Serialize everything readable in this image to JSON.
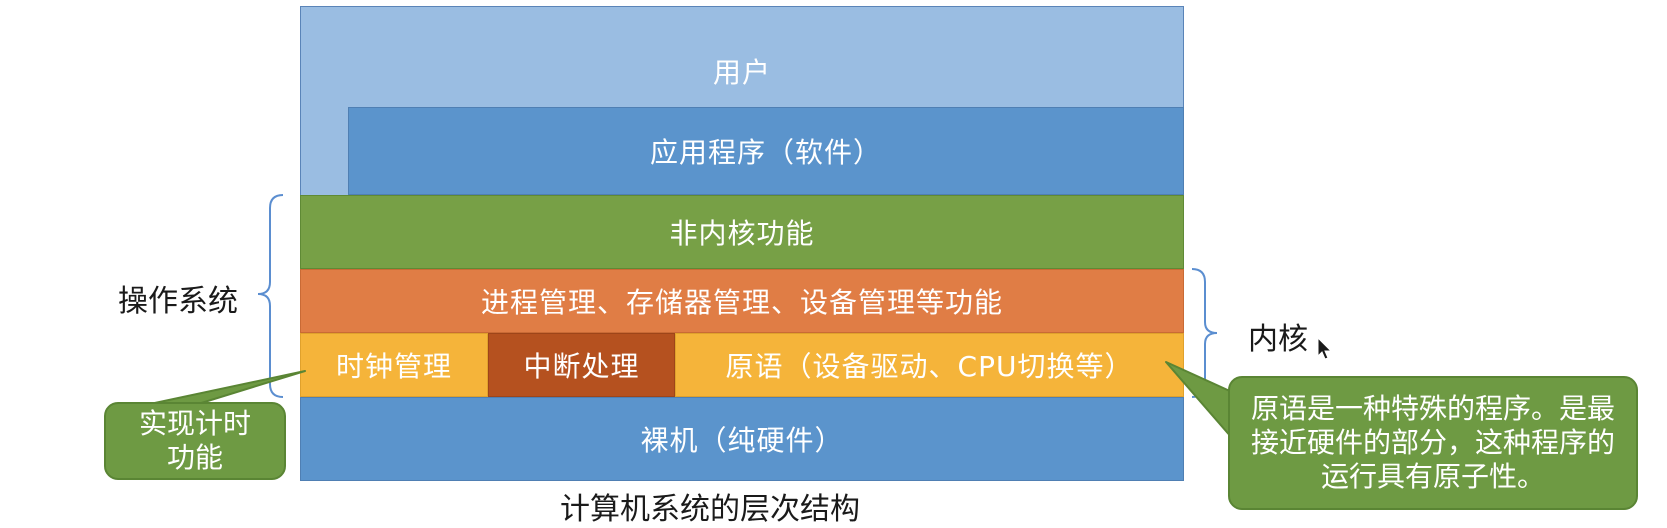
{
  "diagram": {
    "layers": {
      "user": "用户",
      "application": "应用程序（软件）",
      "non_kernel": "非内核功能",
      "management": "进程管理、存储器管理、设备管理等功能",
      "clock": "时钟管理",
      "interrupt": "中断处理",
      "primitive": "原语（设备驱动、CPU切换等）",
      "bare_metal": "裸机（纯硬件）"
    },
    "os_label": "操作系统",
    "kernel_label": "内核",
    "timer_callout": "实现计时功能",
    "primitive_callout": "原语是一种特殊的程序。是最接近硬件的部分，这种程序的运行具有原子性。",
    "caption": "计算机系统的层次结构"
  },
  "colors": {
    "user": "#9abde2",
    "blue": "#5b94cc",
    "green": "#77a046",
    "orange": "#e07d45",
    "yellow": "#f5b43a",
    "rust": "#b5511f",
    "callout_green": "#6e9a43"
  }
}
